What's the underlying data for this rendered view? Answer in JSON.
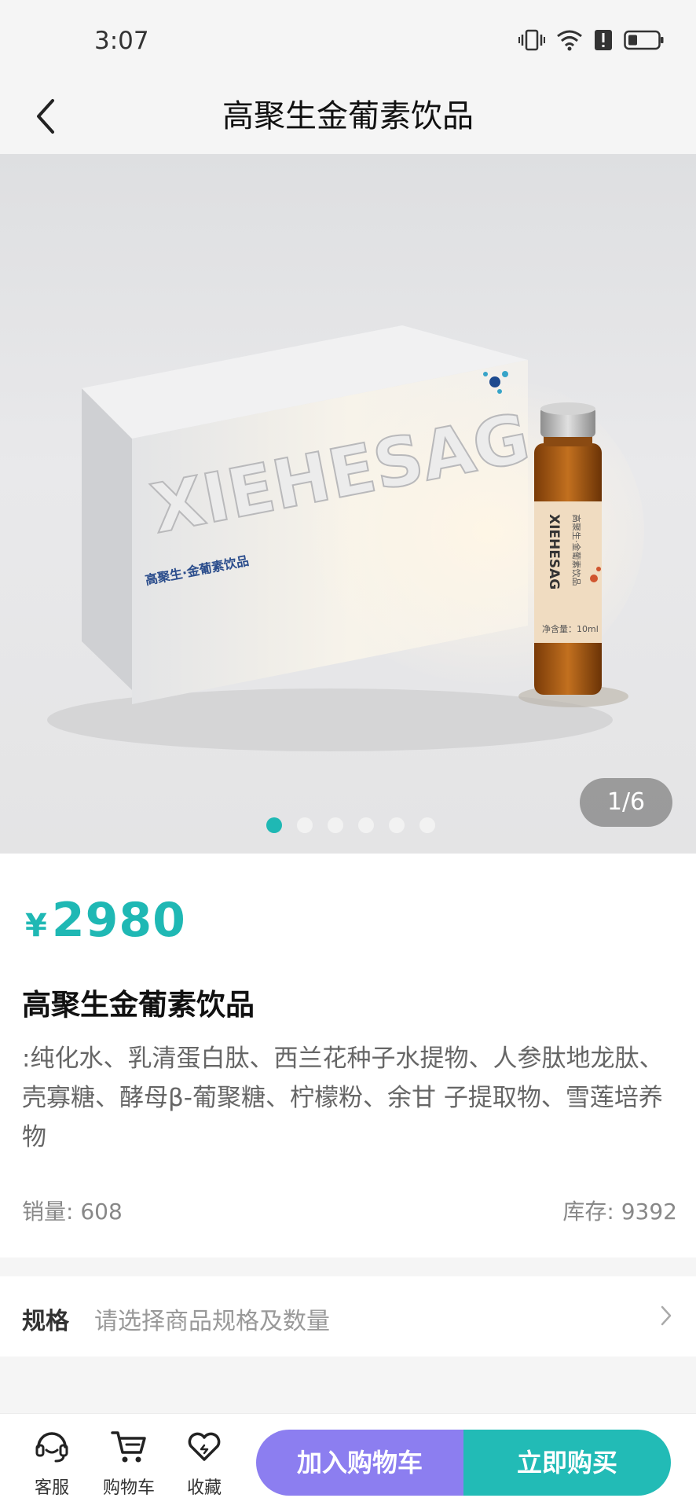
{
  "status_bar": {
    "time": "3:07"
  },
  "header": {
    "title": "高聚生金葡素饮品"
  },
  "gallery": {
    "current_page": "1/6",
    "image_count": 6,
    "active_index": 0,
    "product_text": {
      "brand": "XIEHESAG",
      "box_label": "高聚生·金葡素饮品",
      "vial_label": "高聚生·金葡素饮品",
      "vial_net": "净含量：10ml"
    }
  },
  "product": {
    "currency": "¥",
    "price": "2980",
    "name": "高聚生金葡素饮品",
    "description": ":纯化水、乳清蛋白肽、西兰花种子水提物、人参肽地龙肽、壳寡糖、酵母β-葡聚糖、柠檬粉、余甘 子提取物、雪莲培养物",
    "sales_label": "销量:",
    "sales_value": "608",
    "stock_label": "库存:",
    "stock_value": "9392"
  },
  "spec": {
    "label": "规格",
    "placeholder": "请选择商品规格及数量"
  },
  "bottom_bar": {
    "service_label": "客服",
    "cart_label": "购物车",
    "favorite_label": "收藏",
    "add_to_cart": "加入购物车",
    "buy_now": "立即购买"
  },
  "colors": {
    "accent": "#1fb8b4",
    "add_cart_button": "#8c7ef0",
    "buy_button": "#22bbb6"
  }
}
